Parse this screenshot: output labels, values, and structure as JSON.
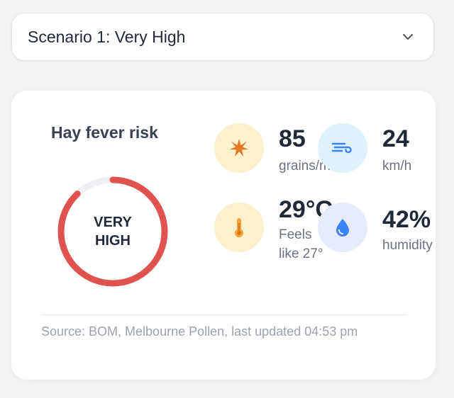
{
  "scenario_select": {
    "value": "Scenario 1: Very High",
    "icon": "chevron-down-icon"
  },
  "risk": {
    "title": "Hay fever risk",
    "level_line1": "VERY",
    "level_line2": "HIGH",
    "level_fraction": 0.88,
    "color": "#e0524f"
  },
  "metrics": {
    "pollen": {
      "value": "85",
      "label": "grains/m³",
      "icon": "pollen-star-icon"
    },
    "wind": {
      "value": "24",
      "label": "km/h",
      "icon": "wind-icon"
    },
    "temperature": {
      "value": "29°C",
      "label": "Feels like 27°",
      "icon": "thermometer-icon"
    },
    "humidity": {
      "value": "42%",
      "label": "humidity",
      "icon": "humidity-drop-icon"
    }
  },
  "source": "Source: BOM, Melbourne Pollen, last updated 04:53 pm",
  "colors": {
    "accent_orange": "#e07b2a",
    "accent_blue": "#3b82f6",
    "risk_red": "#e0524f"
  }
}
